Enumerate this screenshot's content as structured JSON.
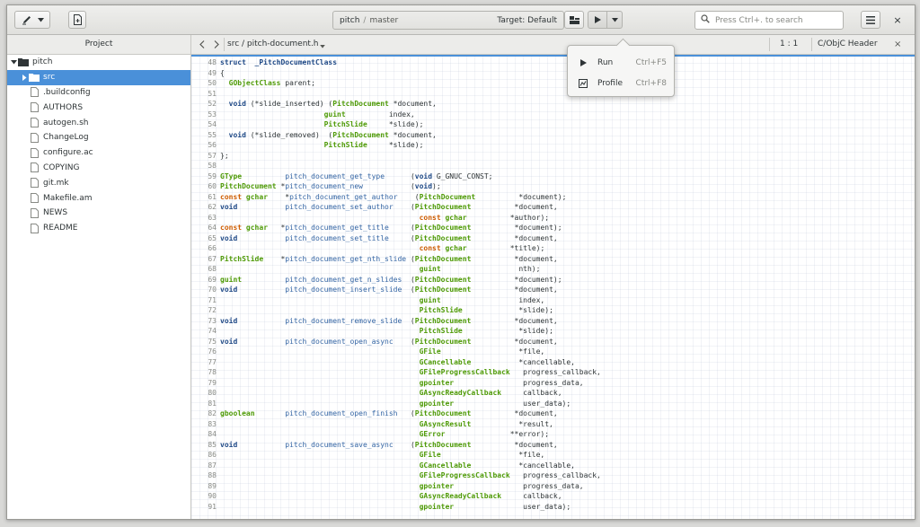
{
  "header": {
    "project": "pitch",
    "separator": "/",
    "branch": "master",
    "target": "Target: Default",
    "search_placeholder": "Press Ctrl+. to search",
    "close": "×"
  },
  "sidebar": {
    "title": "Project",
    "items": [
      {
        "label": "pitch",
        "type": "folder",
        "expanded": true,
        "indent": 0
      },
      {
        "label": "src",
        "type": "folder",
        "expanded": false,
        "indent": 1,
        "selected": true
      },
      {
        "label": ".buildconfig",
        "type": "file",
        "indent": 1
      },
      {
        "label": "AUTHORS",
        "type": "file",
        "indent": 1
      },
      {
        "label": "autogen.sh",
        "type": "file",
        "indent": 1
      },
      {
        "label": "ChangeLog",
        "type": "file",
        "indent": 1
      },
      {
        "label": "configure.ac",
        "type": "file",
        "indent": 1
      },
      {
        "label": "COPYING",
        "type": "file",
        "indent": 1
      },
      {
        "label": "git.mk",
        "type": "file",
        "indent": 1
      },
      {
        "label": "Makefile.am",
        "type": "file",
        "indent": 1
      },
      {
        "label": "NEWS",
        "type": "file",
        "indent": 1
      },
      {
        "label": "README",
        "type": "file",
        "indent": 1
      }
    ]
  },
  "editor": {
    "filename": "src / pitch-document.h",
    "position": "1 : 1",
    "language": "C/ObjC Header",
    "close": "×",
    "first_line": 48,
    "lines": [
      [
        [
          "kw",
          "struct"
        ],
        [
          "",
          "  "
        ],
        [
          "kw",
          "_PitchDocumentClass"
        ]
      ],
      [
        [
          "",
          "{"
        ]
      ],
      [
        [
          "",
          "  "
        ],
        [
          "ty",
          "GObjectClass"
        ],
        [
          "",
          " parent;"
        ]
      ],
      [
        [
          "",
          ""
        ]
      ],
      [
        [
          "",
          "  "
        ],
        [
          "kw",
          "void"
        ],
        [
          "",
          " (*slide_inserted) ("
        ],
        [
          "ty",
          "PitchDocument"
        ],
        [
          "",
          " *document,"
        ]
      ],
      [
        [
          "",
          "                        "
        ],
        [
          "ty",
          "guint"
        ],
        [
          "",
          "          index,"
        ]
      ],
      [
        [
          "",
          "                        "
        ],
        [
          "ty",
          "PitchSlide"
        ],
        [
          "",
          "     *slide);"
        ]
      ],
      [
        [
          "",
          "  "
        ],
        [
          "kw",
          "void"
        ],
        [
          "",
          " (*slide_removed)  ("
        ],
        [
          "ty",
          "PitchDocument"
        ],
        [
          "",
          " *document,"
        ]
      ],
      [
        [
          "",
          "                        "
        ],
        [
          "ty",
          "PitchSlide"
        ],
        [
          "",
          "     *slide);"
        ]
      ],
      [
        [
          "",
          "};"
        ]
      ],
      [
        [
          "",
          ""
        ]
      ],
      [
        [
          "ty",
          "GType"
        ],
        [
          "",
          "          "
        ],
        [
          "fn",
          "pitch_document_get_type"
        ],
        [
          "",
          "      ("
        ],
        [
          "kw",
          "void"
        ],
        [
          "",
          " G_GNUC_CONST;"
        ]
      ],
      [
        [
          "ty",
          "PitchDocument"
        ],
        [
          "",
          " *"
        ],
        [
          "fn",
          "pitch_document_new"
        ],
        [
          "",
          "           ("
        ],
        [
          "kw",
          "void"
        ],
        [
          "",
          ");"
        ]
      ],
      [
        [
          "mod",
          "const"
        ],
        [
          "",
          " "
        ],
        [
          "ty",
          "gchar"
        ],
        [
          "",
          "    *"
        ],
        [
          "fn",
          "pitch_document_get_author"
        ],
        [
          "",
          "    ("
        ],
        [
          "ty",
          "PitchDocument"
        ],
        [
          "",
          "          *document);"
        ]
      ],
      [
        [
          "kw",
          "void"
        ],
        [
          "",
          "           "
        ],
        [
          "fn",
          "pitch_document_set_author"
        ],
        [
          "",
          "    ("
        ],
        [
          "ty",
          "PitchDocument"
        ],
        [
          "",
          "          *document,"
        ]
      ],
      [
        [
          "",
          "                                              "
        ],
        [
          "mod",
          "const"
        ],
        [
          "",
          " "
        ],
        [
          "ty",
          "gchar"
        ],
        [
          "",
          "          *author);"
        ]
      ],
      [
        [
          "mod",
          "const"
        ],
        [
          "",
          " "
        ],
        [
          "ty",
          "gchar"
        ],
        [
          "",
          "   *"
        ],
        [
          "fn",
          "pitch_document_get_title"
        ],
        [
          "",
          "     ("
        ],
        [
          "ty",
          "PitchDocument"
        ],
        [
          "",
          "          *document);"
        ]
      ],
      [
        [
          "kw",
          "void"
        ],
        [
          "",
          "           "
        ],
        [
          "fn",
          "pitch_document_set_title"
        ],
        [
          "",
          "     ("
        ],
        [
          "ty",
          "PitchDocument"
        ],
        [
          "",
          "          *document,"
        ]
      ],
      [
        [
          "",
          "                                              "
        ],
        [
          "mod",
          "const"
        ],
        [
          "",
          " "
        ],
        [
          "ty",
          "gchar"
        ],
        [
          "",
          "          *title);"
        ]
      ],
      [
        [
          "ty",
          "PitchSlide"
        ],
        [
          "",
          "    *"
        ],
        [
          "fn",
          "pitch_document_get_nth_slide"
        ],
        [
          "",
          " ("
        ],
        [
          "ty",
          "PitchDocument"
        ],
        [
          "",
          "          *document,"
        ]
      ],
      [
        [
          "",
          "                                              "
        ],
        [
          "ty",
          "guint"
        ],
        [
          "",
          "                  nth);"
        ]
      ],
      [
        [
          "ty",
          "guint"
        ],
        [
          "",
          "          "
        ],
        [
          "fn",
          "pitch_document_get_n_slides"
        ],
        [
          "",
          "  ("
        ],
        [
          "ty",
          "PitchDocument"
        ],
        [
          "",
          "          *document);"
        ]
      ],
      [
        [
          "kw",
          "void"
        ],
        [
          "",
          "           "
        ],
        [
          "fn",
          "pitch_document_insert_slide"
        ],
        [
          "",
          "  ("
        ],
        [
          "ty",
          "PitchDocument"
        ],
        [
          "",
          "          *document,"
        ]
      ],
      [
        [
          "",
          "                                              "
        ],
        [
          "ty",
          "guint"
        ],
        [
          "",
          "                  index,"
        ]
      ],
      [
        [
          "",
          "                                              "
        ],
        [
          "ty",
          "PitchSlide"
        ],
        [
          "",
          "             *slide);"
        ]
      ],
      [
        [
          "kw",
          "void"
        ],
        [
          "",
          "           "
        ],
        [
          "fn",
          "pitch_document_remove_slide"
        ],
        [
          "",
          "  ("
        ],
        [
          "ty",
          "PitchDocument"
        ],
        [
          "",
          "          *document,"
        ]
      ],
      [
        [
          "",
          "                                              "
        ],
        [
          "ty",
          "PitchSlide"
        ],
        [
          "",
          "             *slide);"
        ]
      ],
      [
        [
          "kw",
          "void"
        ],
        [
          "",
          "           "
        ],
        [
          "fn",
          "pitch_document_open_async"
        ],
        [
          "",
          "    ("
        ],
        [
          "ty",
          "PitchDocument"
        ],
        [
          "",
          "          *document,"
        ]
      ],
      [
        [
          "",
          "                                              "
        ],
        [
          "ty",
          "GFile"
        ],
        [
          "",
          "                  *file,"
        ]
      ],
      [
        [
          "",
          "                                              "
        ],
        [
          "ty",
          "GCancellable"
        ],
        [
          "",
          "           *cancellable,"
        ]
      ],
      [
        [
          "",
          "                                              "
        ],
        [
          "ty",
          "GFileProgressCallback"
        ],
        [
          "",
          "   progress_callback,"
        ]
      ],
      [
        [
          "",
          "                                              "
        ],
        [
          "ty",
          "gpointer"
        ],
        [
          "",
          "                progress_data,"
        ]
      ],
      [
        [
          "",
          "                                              "
        ],
        [
          "ty",
          "GAsyncReadyCallback"
        ],
        [
          "",
          "     callback,"
        ]
      ],
      [
        [
          "",
          "                                              "
        ],
        [
          "ty",
          "gpointer"
        ],
        [
          "",
          "                user_data);"
        ]
      ],
      [
        [
          "ty",
          "gboolean"
        ],
        [
          "",
          "       "
        ],
        [
          "fn",
          "pitch_document_open_finish"
        ],
        [
          "",
          "   ("
        ],
        [
          "ty",
          "PitchDocument"
        ],
        [
          "",
          "          *document,"
        ]
      ],
      [
        [
          "",
          "                                              "
        ],
        [
          "ty",
          "GAsyncResult"
        ],
        [
          "",
          "           *result,"
        ]
      ],
      [
        [
          "",
          "                                              "
        ],
        [
          "ty",
          "GError"
        ],
        [
          "",
          "               **error);"
        ]
      ],
      [
        [
          "kw",
          "void"
        ],
        [
          "",
          "           "
        ],
        [
          "fn",
          "pitch_document_save_async"
        ],
        [
          "",
          "    ("
        ],
        [
          "ty",
          "PitchDocument"
        ],
        [
          "",
          "          *document,"
        ]
      ],
      [
        [
          "",
          "                                              "
        ],
        [
          "ty",
          "GFile"
        ],
        [
          "",
          "                  *file,"
        ]
      ],
      [
        [
          "",
          "                                              "
        ],
        [
          "ty",
          "GCancellable"
        ],
        [
          "",
          "           *cancellable,"
        ]
      ],
      [
        [
          "",
          "                                              "
        ],
        [
          "ty",
          "GFileProgressCallback"
        ],
        [
          "",
          "   progress_callback,"
        ]
      ],
      [
        [
          "",
          "                                              "
        ],
        [
          "ty",
          "gpointer"
        ],
        [
          "",
          "                progress_data,"
        ]
      ],
      [
        [
          "",
          "                                              "
        ],
        [
          "ty",
          "GAsyncReadyCallback"
        ],
        [
          "",
          "     callback,"
        ]
      ],
      [
        [
          "",
          "                                              "
        ],
        [
          "ty",
          "gpointer"
        ],
        [
          "",
          "                user_data);"
        ]
      ]
    ]
  },
  "popover": {
    "items": [
      {
        "label": "Run",
        "accel": "Ctrl+F5",
        "icon": "play-icon"
      },
      {
        "label": "Profile",
        "accel": "Ctrl+F8",
        "icon": "profile-icon"
      }
    ]
  },
  "colors": {
    "accent": "#4a90d9",
    "keyword": "#204a87",
    "type": "#4e9a06",
    "function": "#3465a4",
    "modifier": "#ce5c00"
  }
}
